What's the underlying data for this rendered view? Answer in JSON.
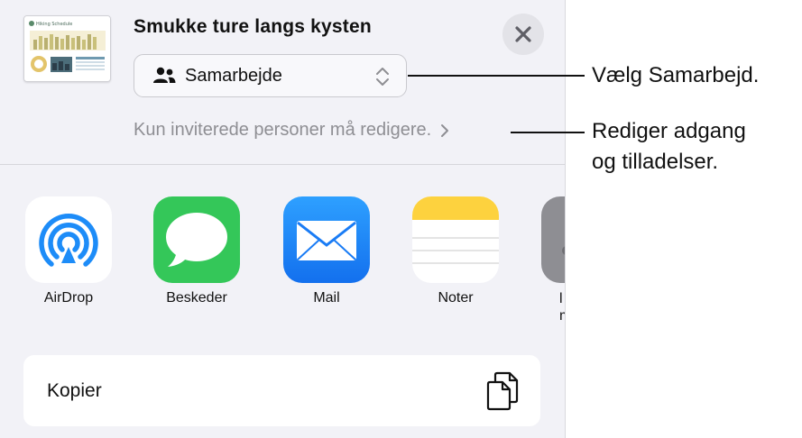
{
  "share_sheet": {
    "document_title": "Smukke ture langs kysten",
    "thumbnail_heading": "Hiking Schedule",
    "collab_select": {
      "label": "Samarbejde"
    },
    "access_text": "Kun inviterede personer må redigere.",
    "apps": [
      {
        "label": "AirDrop",
        "icon": "airdrop-icon",
        "color": "#1d8cf8"
      },
      {
        "label": "Beskeder",
        "icon": "messages-icon",
        "color": "#34c759"
      },
      {
        "label": "Mail",
        "icon": "mail-icon",
        "color": "#1a7cf5"
      },
      {
        "label": "Noter",
        "icon": "notes-icon",
        "color": "#fdd23e"
      },
      {
        "label": "l\nm",
        "icon": "more-app-icon",
        "color": "#8e8e93"
      }
    ],
    "copy_label": "Kopier"
  },
  "callouts": {
    "collaborate": "Vælg Samarbejd.",
    "edit_access_line1": "Rediger adgang",
    "edit_access_line2": "og tilladelser."
  }
}
